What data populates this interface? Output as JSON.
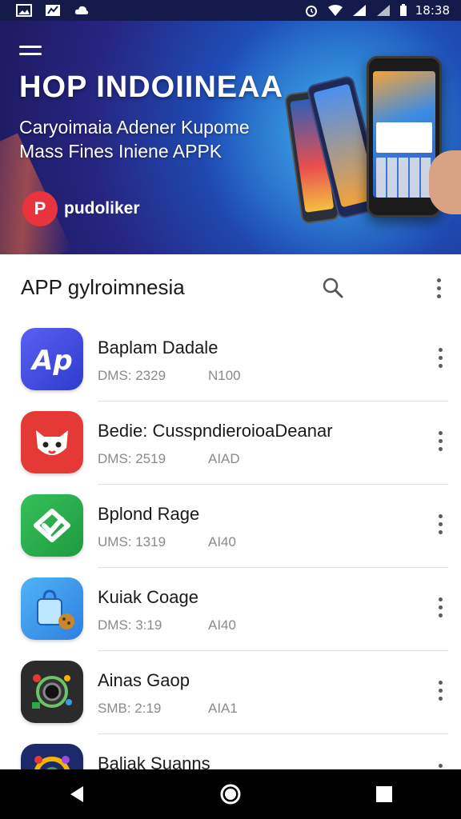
{
  "status_bar": {
    "time": "18:38"
  },
  "banner": {
    "title": "HOP INDOIINEAA",
    "subtitle_line1": "Caryoimaia Adener Kupome",
    "subtitle_line2": "Mass Fines Iniene APPK",
    "brand_logo_letter": "P",
    "brand_name": "pudoliker"
  },
  "header": {
    "title": "APP gylroimnesia"
  },
  "apps": [
    {
      "name": "Baplam Dadale",
      "meta1": "DMS: 2329",
      "meta2": "N100",
      "icon": "ap-logo-icon",
      "color": "#3d4fd8"
    },
    {
      "name": "Bedie: CusspndieroioaDeanar",
      "meta1": "DMS: 2519",
      "meta2": "AIAD",
      "icon": "cat-face-icon",
      "color": "#e53935"
    },
    {
      "name": "Bplond Rage",
      "meta1": "UMS: 1319",
      "meta2": "AI40",
      "icon": "check-box-icon",
      "color": "#2ea84a"
    },
    {
      "name": "Kuiak Coage",
      "meta1": "DMS: 3:19",
      "meta2": "AI40",
      "icon": "shopping-bag-icon",
      "color": "#3a9be8"
    },
    {
      "name": "Ainas Gaop",
      "meta1": "SMB: 2:19",
      "meta2": "AIA1",
      "icon": "camera-lens-icon",
      "color": "#2b2b2b"
    },
    {
      "name": "Baliak Suanns",
      "meta1": "",
      "meta2": "",
      "icon": "colorful-ring-icon",
      "color": "#1c2a6b"
    }
  ]
}
